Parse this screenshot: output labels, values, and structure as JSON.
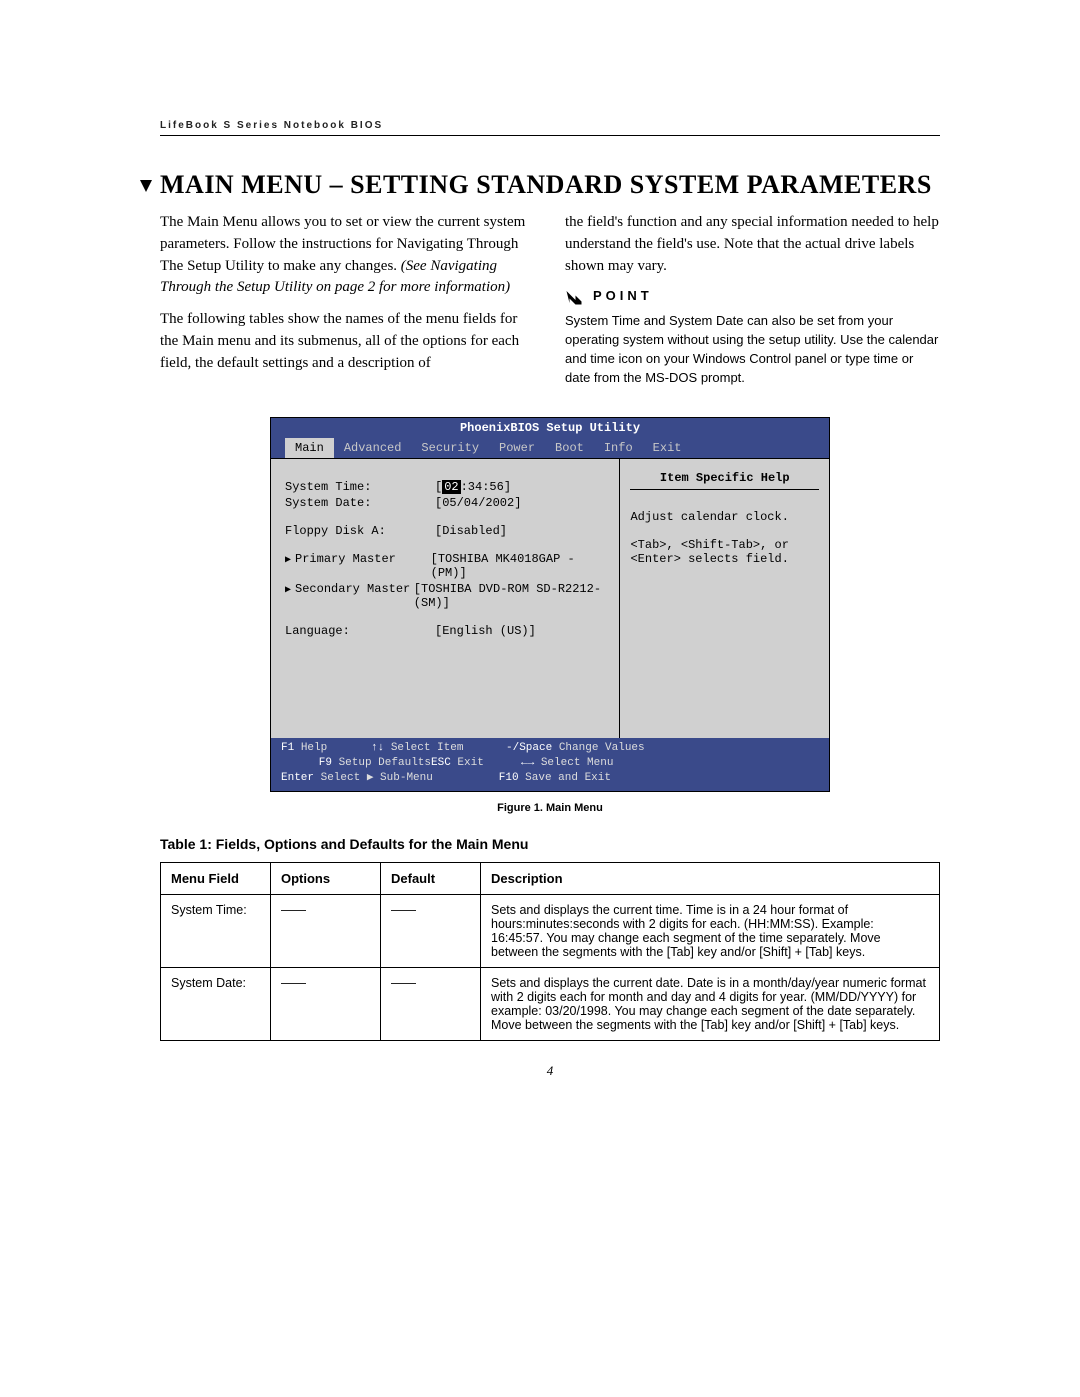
{
  "running_head": "LifeBook S Series Notebook BIOS",
  "title": "MAIN MENU – SETTING STANDARD SYSTEM PARAMETERS",
  "left_col": {
    "p1": "The Main Menu allows you to set or view the current system parameters. Follow the instructions for Navigating Through The Setup Utility to make any changes.",
    "p1_italic": "(See Navigating Through the Setup Utility on page 2 for more information)",
    "p2": "The following tables show the names of the menu fields for the Main menu and its submenus, all of the options for each field, the default settings and a description of"
  },
  "right_col": {
    "p1": "the field's function and any special information needed to help understand the field's use. Note that the actual drive labels shown may vary.",
    "point_label": "POINT",
    "point_body": "System Time and System Date can also be set from your operating system without using the setup utility. Use the calendar and time icon on your Windows Control panel or type time or date from the MS-DOS prompt."
  },
  "bios": {
    "title": "PhoenixBIOS Setup Utility",
    "tabs": [
      "Main",
      "Advanced",
      "Security",
      "Power",
      "Boot",
      "Info",
      "Exit"
    ],
    "active_tab": 0,
    "rows": [
      {
        "label": "System Time:",
        "value_pre": "[",
        "hl": "02",
        "value_post": ":34:56]"
      },
      {
        "label": "System Date:",
        "value": "[05/04/2002]"
      },
      {
        "spacer": true
      },
      {
        "label": "Floppy Disk A:",
        "value": "[Disabled]"
      },
      {
        "spacer": true
      },
      {
        "label": "Primary Master",
        "value": "[TOSHIBA MK4018GAP -(PM)]",
        "tri": true
      },
      {
        "label": "Secondary Master",
        "value": "[TOSHIBA DVD-ROM SD-R2212-(SM)]",
        "tri": true
      },
      {
        "spacer": true
      },
      {
        "label": "Language:",
        "value": "[English (US)]"
      }
    ],
    "help_title": "Item Specific Help",
    "help_lines": [
      "Adjust calendar clock.",
      "",
      "<Tab>, <Shift-Tab>, or",
      "<Enter> selects field."
    ],
    "footer": {
      "row1": [
        {
          "k": "F1",
          "t": "Help"
        },
        {
          "k": "↑↓",
          "t": "Select Item"
        },
        {
          "k": "-/Space",
          "t": "Change Values"
        },
        {
          "k": "F9",
          "t": "Setup Defaults"
        }
      ],
      "row2": [
        {
          "k": "ESC",
          "t": "Exit"
        },
        {
          "k": "←→",
          "t": "Select Menu"
        },
        {
          "k": "Enter",
          "t": "Select ▶ Sub-Menu"
        },
        {
          "k": "F10",
          "t": "Save and Exit"
        }
      ]
    }
  },
  "figure_caption": "Figure 1.   Main Menu",
  "table_title": "Table 1: Fields, Options and Defaults for the Main Menu",
  "table": {
    "headers": [
      "Menu Field",
      "Options",
      "Default",
      "Description"
    ],
    "rows": [
      {
        "field": "System Time:",
        "options": "——",
        "default": "——",
        "desc": "Sets and displays the current time. Time is in a 24 hour format of hours:minutes:seconds with 2 digits for each. (HH:MM:SS). Example: 16:45:57. You may change each segment of the time separately. Move between the segments with the [Tab] key and/or [Shift] + [Tab] keys."
      },
      {
        "field": "System Date:",
        "options": "——",
        "default": "——",
        "desc": "Sets and displays the current date. Date is in a month/day/year numeric format with 2 digits each for month and day and 4 digits for year. (MM/DD/YYYY) for example: 03/20/1998. You may change each segment of the date separately. Move between the segments with the [Tab] key and/or [Shift] + [Tab] keys."
      }
    ]
  },
  "page_number": "4"
}
